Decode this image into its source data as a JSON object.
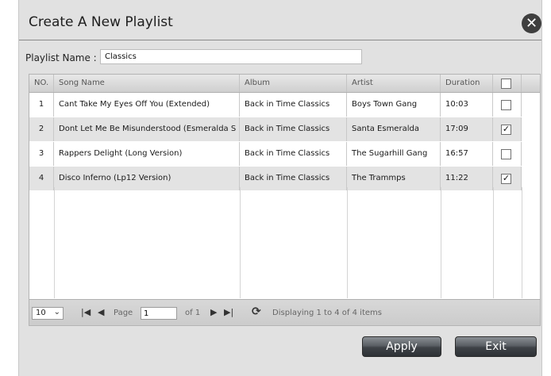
{
  "dialog": {
    "title": "Create A New Playlist",
    "close_symbol": "✕"
  },
  "playlist": {
    "label": "Playlist Name :",
    "value": "Classics"
  },
  "grid": {
    "headers": {
      "no": "NO.",
      "song": "Song Name",
      "album": "Album",
      "artist": "Artist",
      "duration": "Duration"
    },
    "rows": [
      {
        "no": "1",
        "song": "Cant Take My Eyes Off You (Extended)",
        "album": "Back in Time Classics",
        "artist": "Boys Town Gang",
        "duration": "10:03",
        "checked": false
      },
      {
        "no": "2",
        "song": "Dont Let Me Be Misunderstood (Esmeralda S",
        "album": "Back in Time Classics",
        "artist": "Santa Esmeralda",
        "duration": "17:09",
        "checked": true
      },
      {
        "no": "3",
        "song": "Rappers Delight (Long Version)",
        "album": "Back in Time Classics",
        "artist": "The Sugarhill Gang",
        "duration": "16:57",
        "checked": false
      },
      {
        "no": "4",
        "song": "Disco Inferno (Lp12 Version)",
        "album": "Back in Time Classics",
        "artist": "The Trammps",
        "duration": "11:22",
        "checked": true
      }
    ]
  },
  "pager": {
    "page_size": "10",
    "page_label": "Page",
    "page_value": "1",
    "of_label": "of 1",
    "status": "Displaying 1 to 4 of 4 items",
    "icons": {
      "first": "first-page-icon",
      "prev": "prev-page-icon",
      "next": "next-page-icon",
      "last": "last-page-icon",
      "refresh": "refresh-icon"
    }
  },
  "buttons": {
    "apply": "Apply",
    "exit": "Exit"
  },
  "colors": {
    "dialog_bg": "#e1e1e1",
    "alt_row": "#e3e3e3",
    "button_dark": "#3e4247",
    "close_bg": "#3e3e3e"
  }
}
